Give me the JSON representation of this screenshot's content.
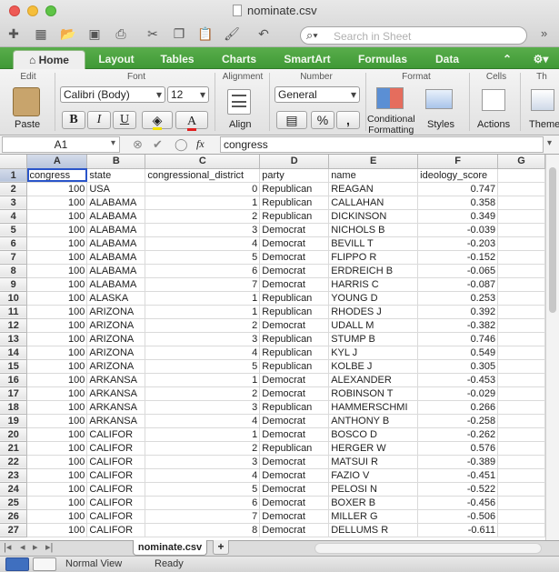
{
  "window": {
    "title": "nominate.csv"
  },
  "toolbar": {
    "search_placeholder": "Search in Sheet"
  },
  "ribbon_tabs": [
    "Home",
    "Layout",
    "Tables",
    "Charts",
    "SmartArt",
    "Formulas",
    "Data"
  ],
  "ribbon": {
    "groups": {
      "edit": "Edit",
      "font": "Font",
      "alignment": "Alignment",
      "number": "Number",
      "format": "Format",
      "cells": "Cells",
      "themes": "Th"
    },
    "paste_label": "Paste",
    "font_name": "Calibri (Body)",
    "font_size": "12",
    "bold": "B",
    "italic": "I",
    "underline": "U",
    "align_label": "Align",
    "number_format": "General",
    "percent": "%",
    "comma": ",",
    "conditional_formatting_line1": "Conditional",
    "conditional_formatting_line2": "Formatting",
    "styles_label": "Styles",
    "actions_label": "Actions",
    "themes_label": "Theme"
  },
  "formula_bar": {
    "name_box": "A1",
    "fx": "fx",
    "content": "congress"
  },
  "grid": {
    "columns": [
      "A",
      "B",
      "C",
      "D",
      "E",
      "F",
      "G"
    ],
    "rows": [
      [
        "1",
        "congress",
        "state",
        "congressional_district",
        "party",
        "name",
        "ideology_score",
        ""
      ],
      [
        "2",
        "100",
        "USA",
        "0",
        "Republican",
        "REAGAN",
        "0.747",
        ""
      ],
      [
        "3",
        "100",
        "ALABAMA",
        "1",
        "Republican",
        "CALLAHAN",
        "0.358",
        ""
      ],
      [
        "4",
        "100",
        "ALABAMA",
        "2",
        "Republican",
        "DICKINSON",
        "0.349",
        ""
      ],
      [
        "5",
        "100",
        "ALABAMA",
        "3",
        "Democrat",
        "NICHOLS  B",
        "-0.039",
        ""
      ],
      [
        "6",
        "100",
        "ALABAMA",
        "4",
        "Democrat",
        "BEVILL  T",
        "-0.203",
        ""
      ],
      [
        "7",
        "100",
        "ALABAMA",
        "5",
        "Democrat",
        "FLIPPO  R",
        "-0.152",
        ""
      ],
      [
        "8",
        "100",
        "ALABAMA",
        "6",
        "Democrat",
        "ERDREICH  B",
        "-0.065",
        ""
      ],
      [
        "9",
        "100",
        "ALABAMA",
        "7",
        "Democrat",
        "HARRIS  C",
        "-0.087",
        ""
      ],
      [
        "10",
        "100",
        "ALASKA",
        "1",
        "Republican",
        "YOUNG  D",
        "0.253",
        ""
      ],
      [
        "11",
        "100",
        "ARIZONA",
        "1",
        "Republican",
        "RHODES  J",
        "0.392",
        ""
      ],
      [
        "12",
        "100",
        "ARIZONA",
        "2",
        "Democrat",
        "UDALL  M",
        "-0.382",
        ""
      ],
      [
        "13",
        "100",
        "ARIZONA",
        "3",
        "Republican",
        "STUMP  B",
        "0.746",
        ""
      ],
      [
        "14",
        "100",
        "ARIZONA",
        "4",
        "Republican",
        "KYL  J",
        "0.549",
        ""
      ],
      [
        "15",
        "100",
        "ARIZONA",
        "5",
        "Republican",
        "KOLBE  J",
        "0.305",
        ""
      ],
      [
        "16",
        "100",
        "ARKANSA",
        "1",
        "Democrat",
        "ALEXANDER",
        "-0.453",
        ""
      ],
      [
        "17",
        "100",
        "ARKANSA",
        "2",
        "Democrat",
        "ROBINSON  T",
        "-0.029",
        ""
      ],
      [
        "18",
        "100",
        "ARKANSA",
        "3",
        "Republican",
        "HAMMERSCHMI",
        "0.266",
        ""
      ],
      [
        "19",
        "100",
        "ARKANSA",
        "4",
        "Democrat",
        "ANTHONY  B",
        "-0.258",
        ""
      ],
      [
        "20",
        "100",
        "CALIFOR",
        "1",
        "Democrat",
        "BOSCO  D",
        "-0.262",
        ""
      ],
      [
        "21",
        "100",
        "CALIFOR",
        "2",
        "Republican",
        "HERGER  W",
        "0.576",
        ""
      ],
      [
        "22",
        "100",
        "CALIFOR",
        "3",
        "Democrat",
        "MATSUI  R",
        "-0.389",
        ""
      ],
      [
        "23",
        "100",
        "CALIFOR",
        "4",
        "Democrat",
        "FAZIO  V",
        "-0.451",
        ""
      ],
      [
        "24",
        "100",
        "CALIFOR",
        "5",
        "Democrat",
        "PELOSI N",
        "-0.522",
        ""
      ],
      [
        "25",
        "100",
        "CALIFOR",
        "6",
        "Democrat",
        "BOXER  B",
        "-0.456",
        ""
      ],
      [
        "26",
        "100",
        "CALIFOR",
        "7",
        "Democrat",
        "MILLER  G",
        "-0.506",
        ""
      ],
      [
        "27",
        "100",
        "CALIFOR",
        "8",
        "Democrat",
        "DELLUMS  R",
        "-0.611",
        ""
      ]
    ]
  },
  "sheet_tab": "nominate.csv",
  "add_sheet": "+",
  "status": {
    "view": "Normal View",
    "state": "Ready"
  }
}
